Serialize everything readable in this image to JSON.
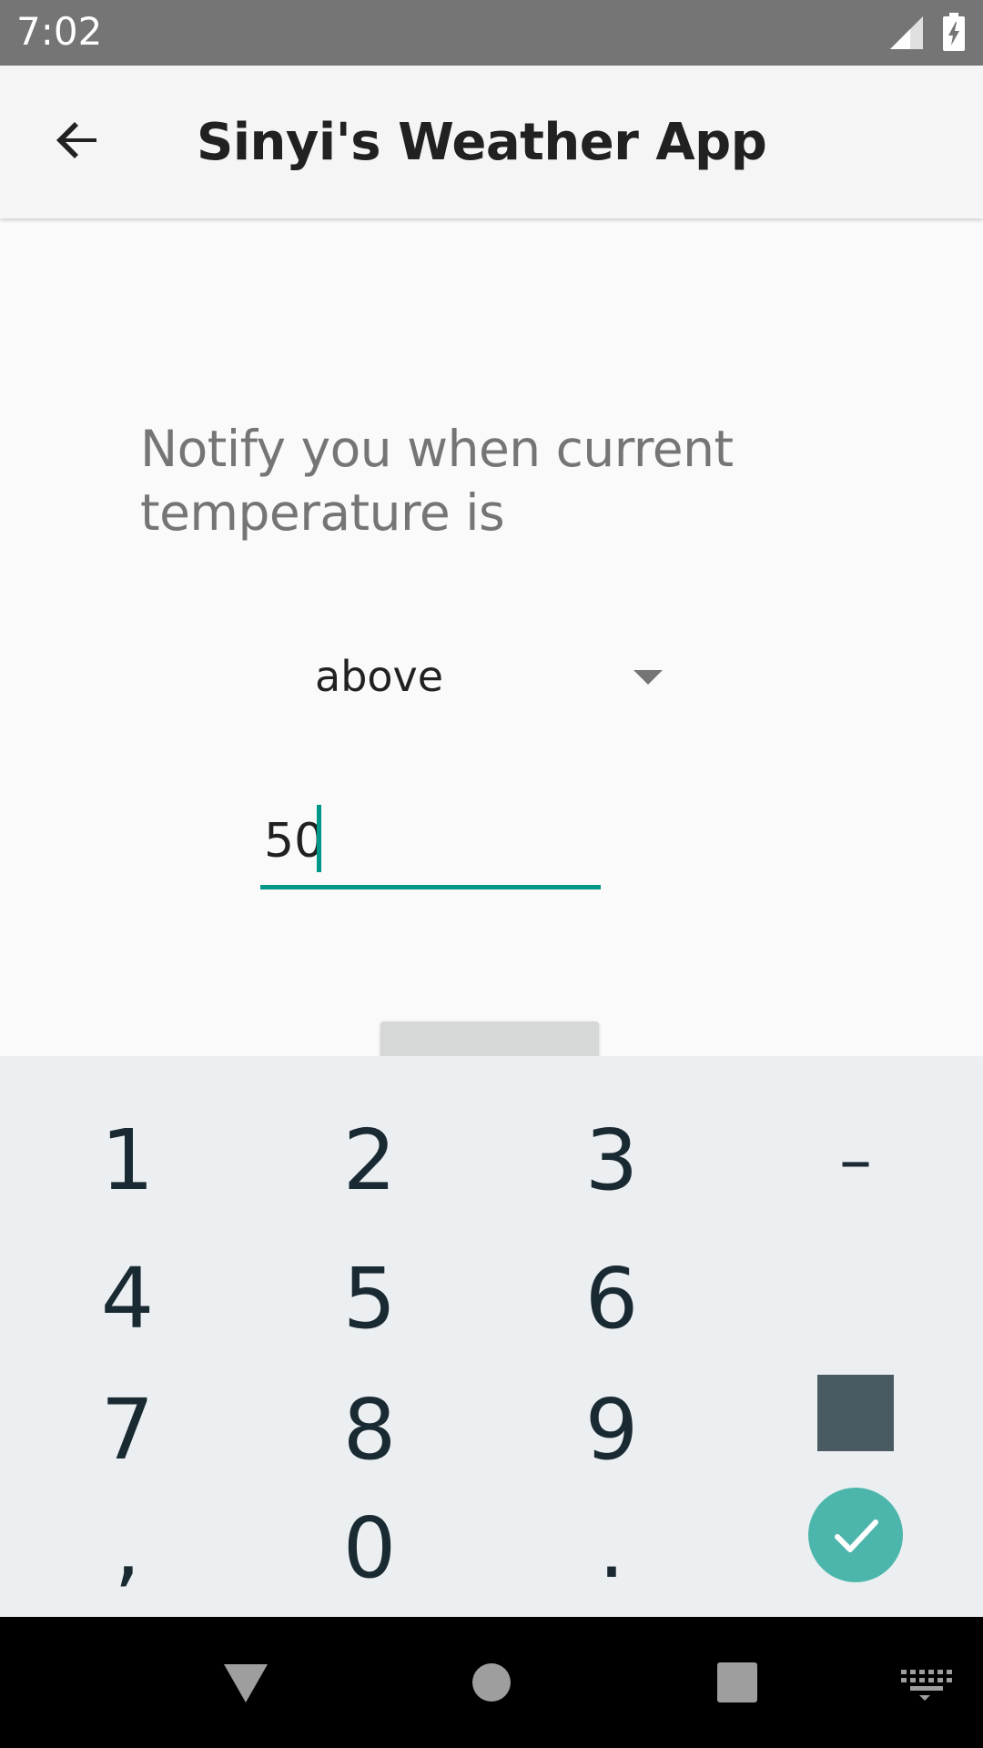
{
  "status_bar": {
    "time": "7:02"
  },
  "toolbar": {
    "title": "Sinyi's Weather App",
    "back_icon": "arrow-back-icon"
  },
  "content": {
    "prompt": "Notify you when current temperature is",
    "condition_select": {
      "value": "above"
    },
    "temperature_input": {
      "value": "50"
    }
  },
  "keyboard": {
    "keys": {
      "k1": "1",
      "k2": "2",
      "k3": "3",
      "minus": "–",
      "k4": "4",
      "k5": "5",
      "k6": "6",
      "k7": "7",
      "k8": "8",
      "k9": "9",
      "comma": ",",
      "k0": "0",
      "period": "."
    },
    "done_icon": "check-icon"
  },
  "nav_bar": {
    "back_icon": "nav-back-icon",
    "home_icon": "nav-home-icon",
    "recents_icon": "nav-recents-icon",
    "keyboard_icon": "keyboard-switch-icon"
  },
  "colors": {
    "status_bar": "#757575",
    "toolbar": "#f5f5f5",
    "accent": "#009688",
    "done_button": "#4db6ac",
    "keyboard": "#eceff1"
  }
}
